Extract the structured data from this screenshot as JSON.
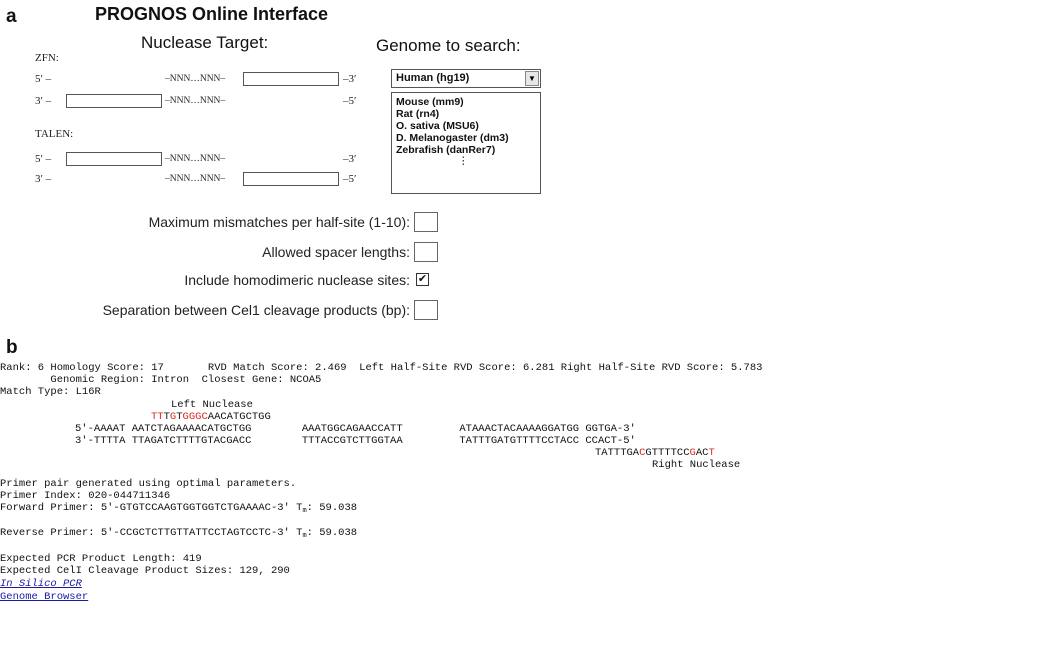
{
  "panel_a": {
    "letter": "a",
    "title": "PROGNOS Online Interface",
    "nuclease_target_heading": "Nuclease Target:",
    "genome_heading": "Genome to search:",
    "zfn": {
      "label": "ZFN:",
      "row1": {
        "prefix": "5′ –",
        "middle": "–NNN…NNN–",
        "suffix": "–3′"
      },
      "row2": {
        "prefix": "3′ –",
        "middle": "–NNN…NNN–",
        "suffix": "–5′"
      }
    },
    "talen": {
      "label": "TALEN:",
      "row1": {
        "prefix": "5′ –",
        "middle": "–NNN…NNN–",
        "suffix": "–3′"
      },
      "row2": {
        "prefix": "3′ –",
        "middle": "–NNN…NNN–",
        "suffix": "–5′"
      }
    },
    "genome_select": {
      "selected": "Human (hg19)",
      "options": [
        "Mouse (mm9)",
        "Rat (rn4)",
        "O. sativa (MSU6)",
        "D. Melanogaster (dm3)",
        "Zebrafish (danRer7)"
      ],
      "more": "⋮"
    },
    "options": {
      "max_mismatches": "Maximum mismatches per half-site (1-10):",
      "spacer_lengths": "Allowed spacer lengths:",
      "homodimeric": "Include homodimeric nuclease sites:",
      "homodimeric_checked": true,
      "check_mark": "✔",
      "cel1_separation": "Separation between Cel1 cleavage products (bp):"
    }
  },
  "panel_b": {
    "letter": "b",
    "header_line1": "Rank: 6 Homology Score: 17       RVD Match Score: 2.469  Left Half-Site RVD Score: 6.281 Right Half-Site RVD Score: 5.783",
    "header_line2": "        Genomic Region: Intron  Closest Gene: NCOA5",
    "match_type": "Match Type: L16R",
    "left_nuclease_label": "Left Nuclease",
    "left_nuc_seq": {
      "r1": "TT",
      "b1": "T",
      "r2": "G",
      "b2": "T",
      "r3": "GGGC",
      "b3": "AACATGCTGG"
    },
    "seq_top": "5'-AAAAT AATCTAGAAAACATGCTGG        AAATGGCAGAACCATT         ATAAACTACAAAAGGATGG GGTGA-3'",
    "seq_bottom": "3'-TTTTA TTAGATCTTTTGTACGACC        TTTACCGTCTTGGTAA         TATTTGATGTTTTCCTACC CCACT-5'",
    "right_nuc_seq": {
      "b1": "TATTTGA",
      "r1": "C",
      "b2": "GTTTTCC",
      "r2": "G",
      "b3": "AC",
      "r3": "T"
    },
    "right_nuclease_label": "Right Nuclease",
    "primer_pair": "Primer pair generated using optimal parameters.",
    "primer_index": "Primer Index: 020-044711346",
    "forward_primer": "Forward Primer: 5'-GTGTCCAAGTGGTGGTCTGAAAAC-3' T",
    "reverse_primer": "Reverse Primer: 5'-CCGCTCTTGTTATTCCTAGTCCTC-3' T",
    "tm_sub": "m",
    "tm_value": ": 59.038",
    "pcr_length": "Expected PCR Product Length: 419",
    "cel_sizes": "Expected CelI Cleavage Product Sizes: 129, 290",
    "link_in_silico": "In Silico PCR",
    "link_genome_browser": "Genome Browser"
  },
  "colors": {
    "highlight": "#d72a1e",
    "link": "#1a1aa6"
  }
}
